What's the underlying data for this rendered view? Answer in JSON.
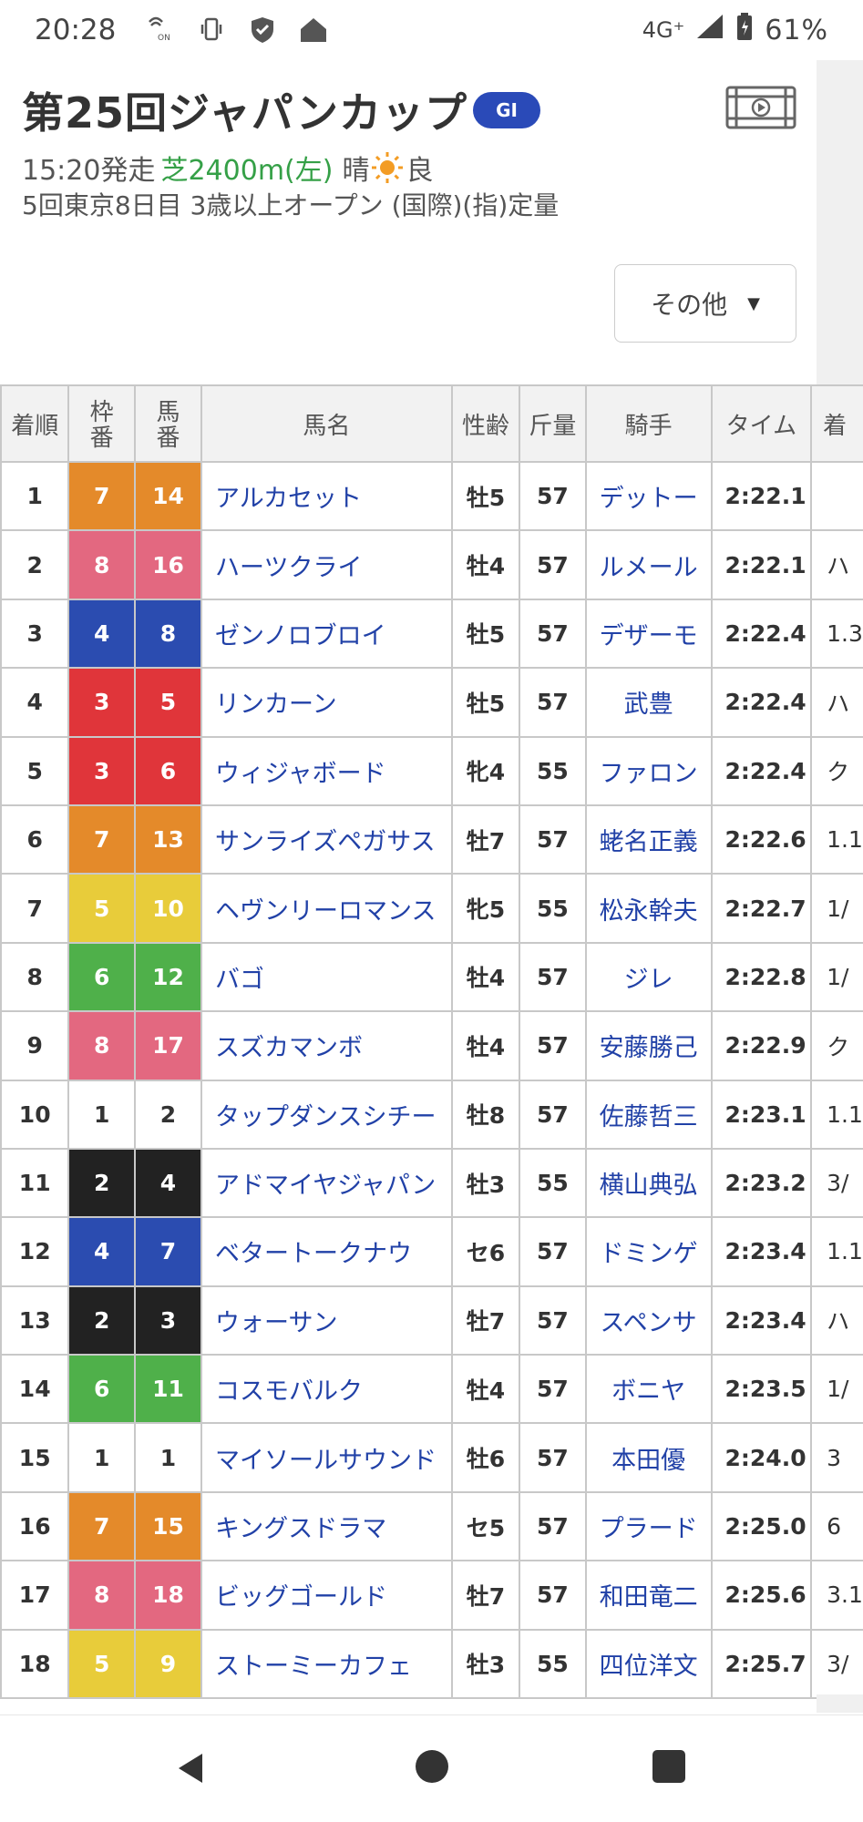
{
  "status_bar": {
    "time": "20:28",
    "network": "4G⁺",
    "battery": "61%",
    "icons": [
      "nfc-icon",
      "vibrate-icon",
      "shield-icon",
      "home-icon",
      "signal-icon",
      "battery-icon"
    ]
  },
  "race": {
    "title": "第25回ジャパンカップ",
    "grade": "GI",
    "start": "15:20発走",
    "course": "芝2400m(左)",
    "weather": "晴",
    "condition": "良",
    "info": "5回東京8日目 3歳以上オープン (国際)(指)定量",
    "other_button": "その他"
  },
  "table": {
    "headers": {
      "rank": "着順",
      "waku": "枠番",
      "umaban": "馬番",
      "horse": "馬名",
      "sex_age": "性齢",
      "weight": "斤量",
      "jockey": "騎手",
      "time": "タイム",
      "margin": "着"
    },
    "waku_colors": {
      "1": {
        "bg": "#ffffff",
        "fg": "#333333"
      },
      "2": {
        "bg": "#222222",
        "fg": "#ffffff"
      },
      "3": {
        "bg": "#e0353a",
        "fg": "#ffffff"
      },
      "4": {
        "bg": "#2b4cb0",
        "fg": "#ffffff"
      },
      "5": {
        "bg": "#e8cc3a",
        "fg": "#ffffff"
      },
      "6": {
        "bg": "#4fb04a",
        "fg": "#ffffff"
      },
      "7": {
        "bg": "#e48a2a",
        "fg": "#ffffff"
      },
      "8": {
        "bg": "#e36880",
        "fg": "#ffffff"
      }
    },
    "rows": [
      {
        "rank": "1",
        "waku": "7",
        "umaban": "14",
        "horse": "アルカセット",
        "sex_age": "牡5",
        "weight": "57",
        "jockey": "デットー",
        "time": "2:22.1",
        "margin": ""
      },
      {
        "rank": "2",
        "waku": "8",
        "umaban": "16",
        "horse": "ハーツクライ",
        "sex_age": "牡4",
        "weight": "57",
        "jockey": "ルメール",
        "time": "2:22.1",
        "margin": "ハ"
      },
      {
        "rank": "3",
        "waku": "4",
        "umaban": "8",
        "horse": "ゼンノロブロイ",
        "sex_age": "牡5",
        "weight": "57",
        "jockey": "デザーモ",
        "time": "2:22.4",
        "margin": "1.3"
      },
      {
        "rank": "4",
        "waku": "3",
        "umaban": "5",
        "horse": "リンカーン",
        "sex_age": "牡5",
        "weight": "57",
        "jockey": "武豊",
        "time": "2:22.4",
        "margin": "ハ"
      },
      {
        "rank": "5",
        "waku": "3",
        "umaban": "6",
        "horse": "ウィジャボード",
        "sex_age": "牝4",
        "weight": "55",
        "jockey": "ファロン",
        "time": "2:22.4",
        "margin": "ク"
      },
      {
        "rank": "6",
        "waku": "7",
        "umaban": "13",
        "horse": "サンライズペガサス",
        "sex_age": "牡7",
        "weight": "57",
        "jockey": "蛯名正義",
        "time": "2:22.6",
        "margin": "1.1"
      },
      {
        "rank": "7",
        "waku": "5",
        "umaban": "10",
        "horse": "ヘヴンリーロマンス",
        "sex_age": "牝5",
        "weight": "55",
        "jockey": "松永幹夫",
        "time": "2:22.7",
        "margin": "1/"
      },
      {
        "rank": "8",
        "waku": "6",
        "umaban": "12",
        "horse": "バゴ",
        "sex_age": "牡4",
        "weight": "57",
        "jockey": "ジレ",
        "time": "2:22.8",
        "margin": "1/"
      },
      {
        "rank": "9",
        "waku": "8",
        "umaban": "17",
        "horse": "スズカマンボ",
        "sex_age": "牡4",
        "weight": "57",
        "jockey": "安藤勝己",
        "time": "2:22.9",
        "margin": "ク"
      },
      {
        "rank": "10",
        "waku": "1",
        "umaban": "2",
        "horse": "タップダンスシチー",
        "sex_age": "牡8",
        "weight": "57",
        "jockey": "佐藤哲三",
        "time": "2:23.1",
        "margin": "1.1"
      },
      {
        "rank": "11",
        "waku": "2",
        "umaban": "4",
        "horse": "アドマイヤジャパン",
        "sex_age": "牡3",
        "weight": "55",
        "jockey": "横山典弘",
        "time": "2:23.2",
        "margin": "3/"
      },
      {
        "rank": "12",
        "waku": "4",
        "umaban": "7",
        "horse": "ベタートークナウ",
        "sex_age": "セ6",
        "weight": "57",
        "jockey": "ドミンゲ",
        "time": "2:23.4",
        "margin": "1.1"
      },
      {
        "rank": "13",
        "waku": "2",
        "umaban": "3",
        "horse": "ウォーサン",
        "sex_age": "牡7",
        "weight": "57",
        "jockey": "スペンサ",
        "time": "2:23.4",
        "margin": "ハ"
      },
      {
        "rank": "14",
        "waku": "6",
        "umaban": "11",
        "horse": "コスモバルク",
        "sex_age": "牡4",
        "weight": "57",
        "jockey": "ボニヤ",
        "time": "2:23.5",
        "margin": "1/"
      },
      {
        "rank": "15",
        "waku": "1",
        "umaban": "1",
        "horse": "マイソールサウンド",
        "sex_age": "牡6",
        "weight": "57",
        "jockey": "本田優",
        "time": "2:24.0",
        "margin": "3"
      },
      {
        "rank": "16",
        "waku": "7",
        "umaban": "15",
        "horse": "キングスドラマ",
        "sex_age": "セ5",
        "weight": "57",
        "jockey": "プラード",
        "time": "2:25.0",
        "margin": "6"
      },
      {
        "rank": "17",
        "waku": "8",
        "umaban": "18",
        "horse": "ビッグゴールド",
        "sex_age": "牡7",
        "weight": "57",
        "jockey": "和田竜二",
        "time": "2:25.6",
        "margin": "3.1"
      },
      {
        "rank": "18",
        "waku": "5",
        "umaban": "9",
        "horse": "ストーミーカフェ",
        "sex_age": "牡3",
        "weight": "55",
        "jockey": "四位洋文",
        "time": "2:25.7",
        "margin": "3/"
      }
    ]
  },
  "nav_bar": {
    "icons": [
      "back-icon",
      "home-circle-icon",
      "recents-icon"
    ]
  }
}
